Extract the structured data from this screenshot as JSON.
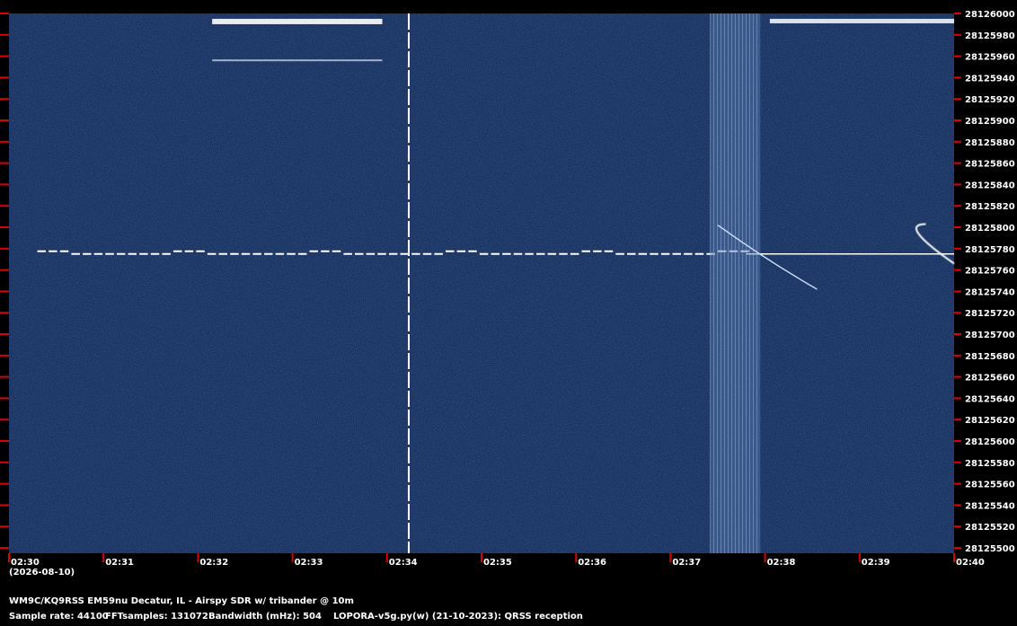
{
  "chart_data": {
    "type": "heatmap",
    "xlabel_date": "(2026-08-10)",
    "x_ticks": [
      "02:30",
      "02:31",
      "02:32",
      "02:33",
      "02:34",
      "02:35",
      "02:36",
      "02:37",
      "02:38",
      "02:39",
      "02:40"
    ],
    "xlim": [
      "02:30",
      "02:40"
    ],
    "y_ticks": [
      28126000,
      28125980,
      28125960,
      28125940,
      28125920,
      28125900,
      28125880,
      28125860,
      28125840,
      28125820,
      28125800,
      28125780,
      28125760,
      28125740,
      28125720,
      28125700,
      28125680,
      28125660,
      28125640,
      28125620,
      28125600,
      28125580,
      28125560,
      28125540,
      28125520,
      28125500
    ],
    "ylim": [
      28125495,
      28126000
    ],
    "colors": {
      "background": "#0a1f4d",
      "signal": "#ffffff",
      "tick": "#e00000",
      "frame": "#000000"
    }
  },
  "info": {
    "station": "WM9C/KQ9RSS EM59nu Decatur, IL - Airspy SDR w/ tribander @ 10m",
    "sample_rate": "Sample rate: 44100",
    "fft_samples": "FFTsamples: 131072",
    "bandwidth": "Bandwidth (mHz): 504",
    "software": "LOPORA-v5g.py(w) (21-10-2023): QRSS reception"
  }
}
